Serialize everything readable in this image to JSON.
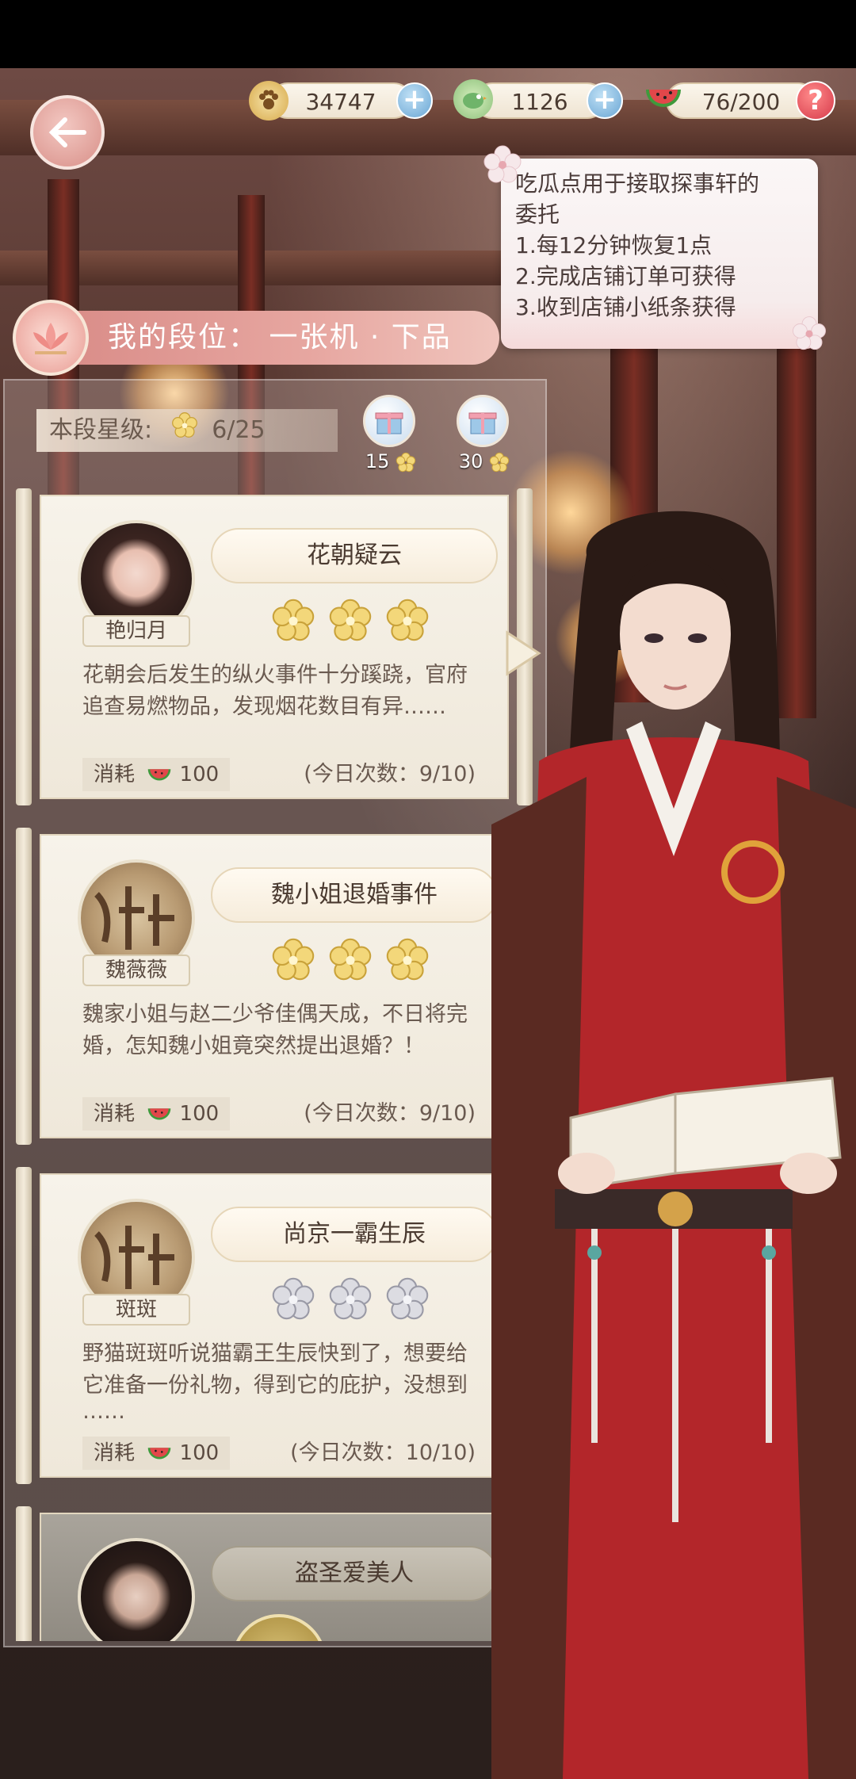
{
  "resources": {
    "paw_value": "34747",
    "gem_value": "1126",
    "stamina_value": "76/200"
  },
  "tooltip": {
    "lines": [
      "吃瓜点用于接取探事轩的",
      "委托",
      "1.每12分钟恢复1点",
      "2.完成店铺订单可获得",
      "3.收到店铺小纸条获得"
    ]
  },
  "rank": {
    "label": "我的段位：  一张机 · 下品"
  },
  "star_level": {
    "label": "本段星级:",
    "value": "6/25"
  },
  "rewards": [
    {
      "label": "15"
    },
    {
      "label": "30"
    }
  ],
  "cards": [
    {
      "avatar_name": "艳归月",
      "title": "花朝疑云",
      "stars": 3,
      "stars_gold": true,
      "desc_lines": [
        "花朝会后发生的纵火事件十分蹊跷，官府",
        "追查易燃物品，发现烟花数目有异……"
      ],
      "cost_label": "消耗",
      "cost_value": "100",
      "count": "(今日次数：9/10)"
    },
    {
      "avatar_name": "魏薇薇",
      "title": "魏小姐退婚事件",
      "stars": 3,
      "stars_gold": true,
      "desc_lines": [
        "魏家小姐与赵二少爷佳偶天成，不日将完",
        "婚，怎知魏小姐竟突然提出退婚？！"
      ],
      "cost_label": "消耗",
      "cost_value": "100",
      "count": "(今日次数：9/10)"
    },
    {
      "avatar_name": "斑斑",
      "title": "尚京一霸生辰",
      "stars": 3,
      "stars_gold": false,
      "desc_lines": [
        "野猫斑斑听说猫霸王生辰快到了，想要给",
        "它准备一份礼物，得到它的庇护，没想到",
        "……"
      ],
      "cost_label": "消耗",
      "cost_value": "100",
      "count": "(今日次数：10/10)"
    },
    {
      "title": "盗圣爱美人"
    }
  ],
  "colors": {
    "accent_pink": "#d88a86",
    "gold_star": "#f3d77a",
    "silver_star": "#c9c9cf"
  }
}
